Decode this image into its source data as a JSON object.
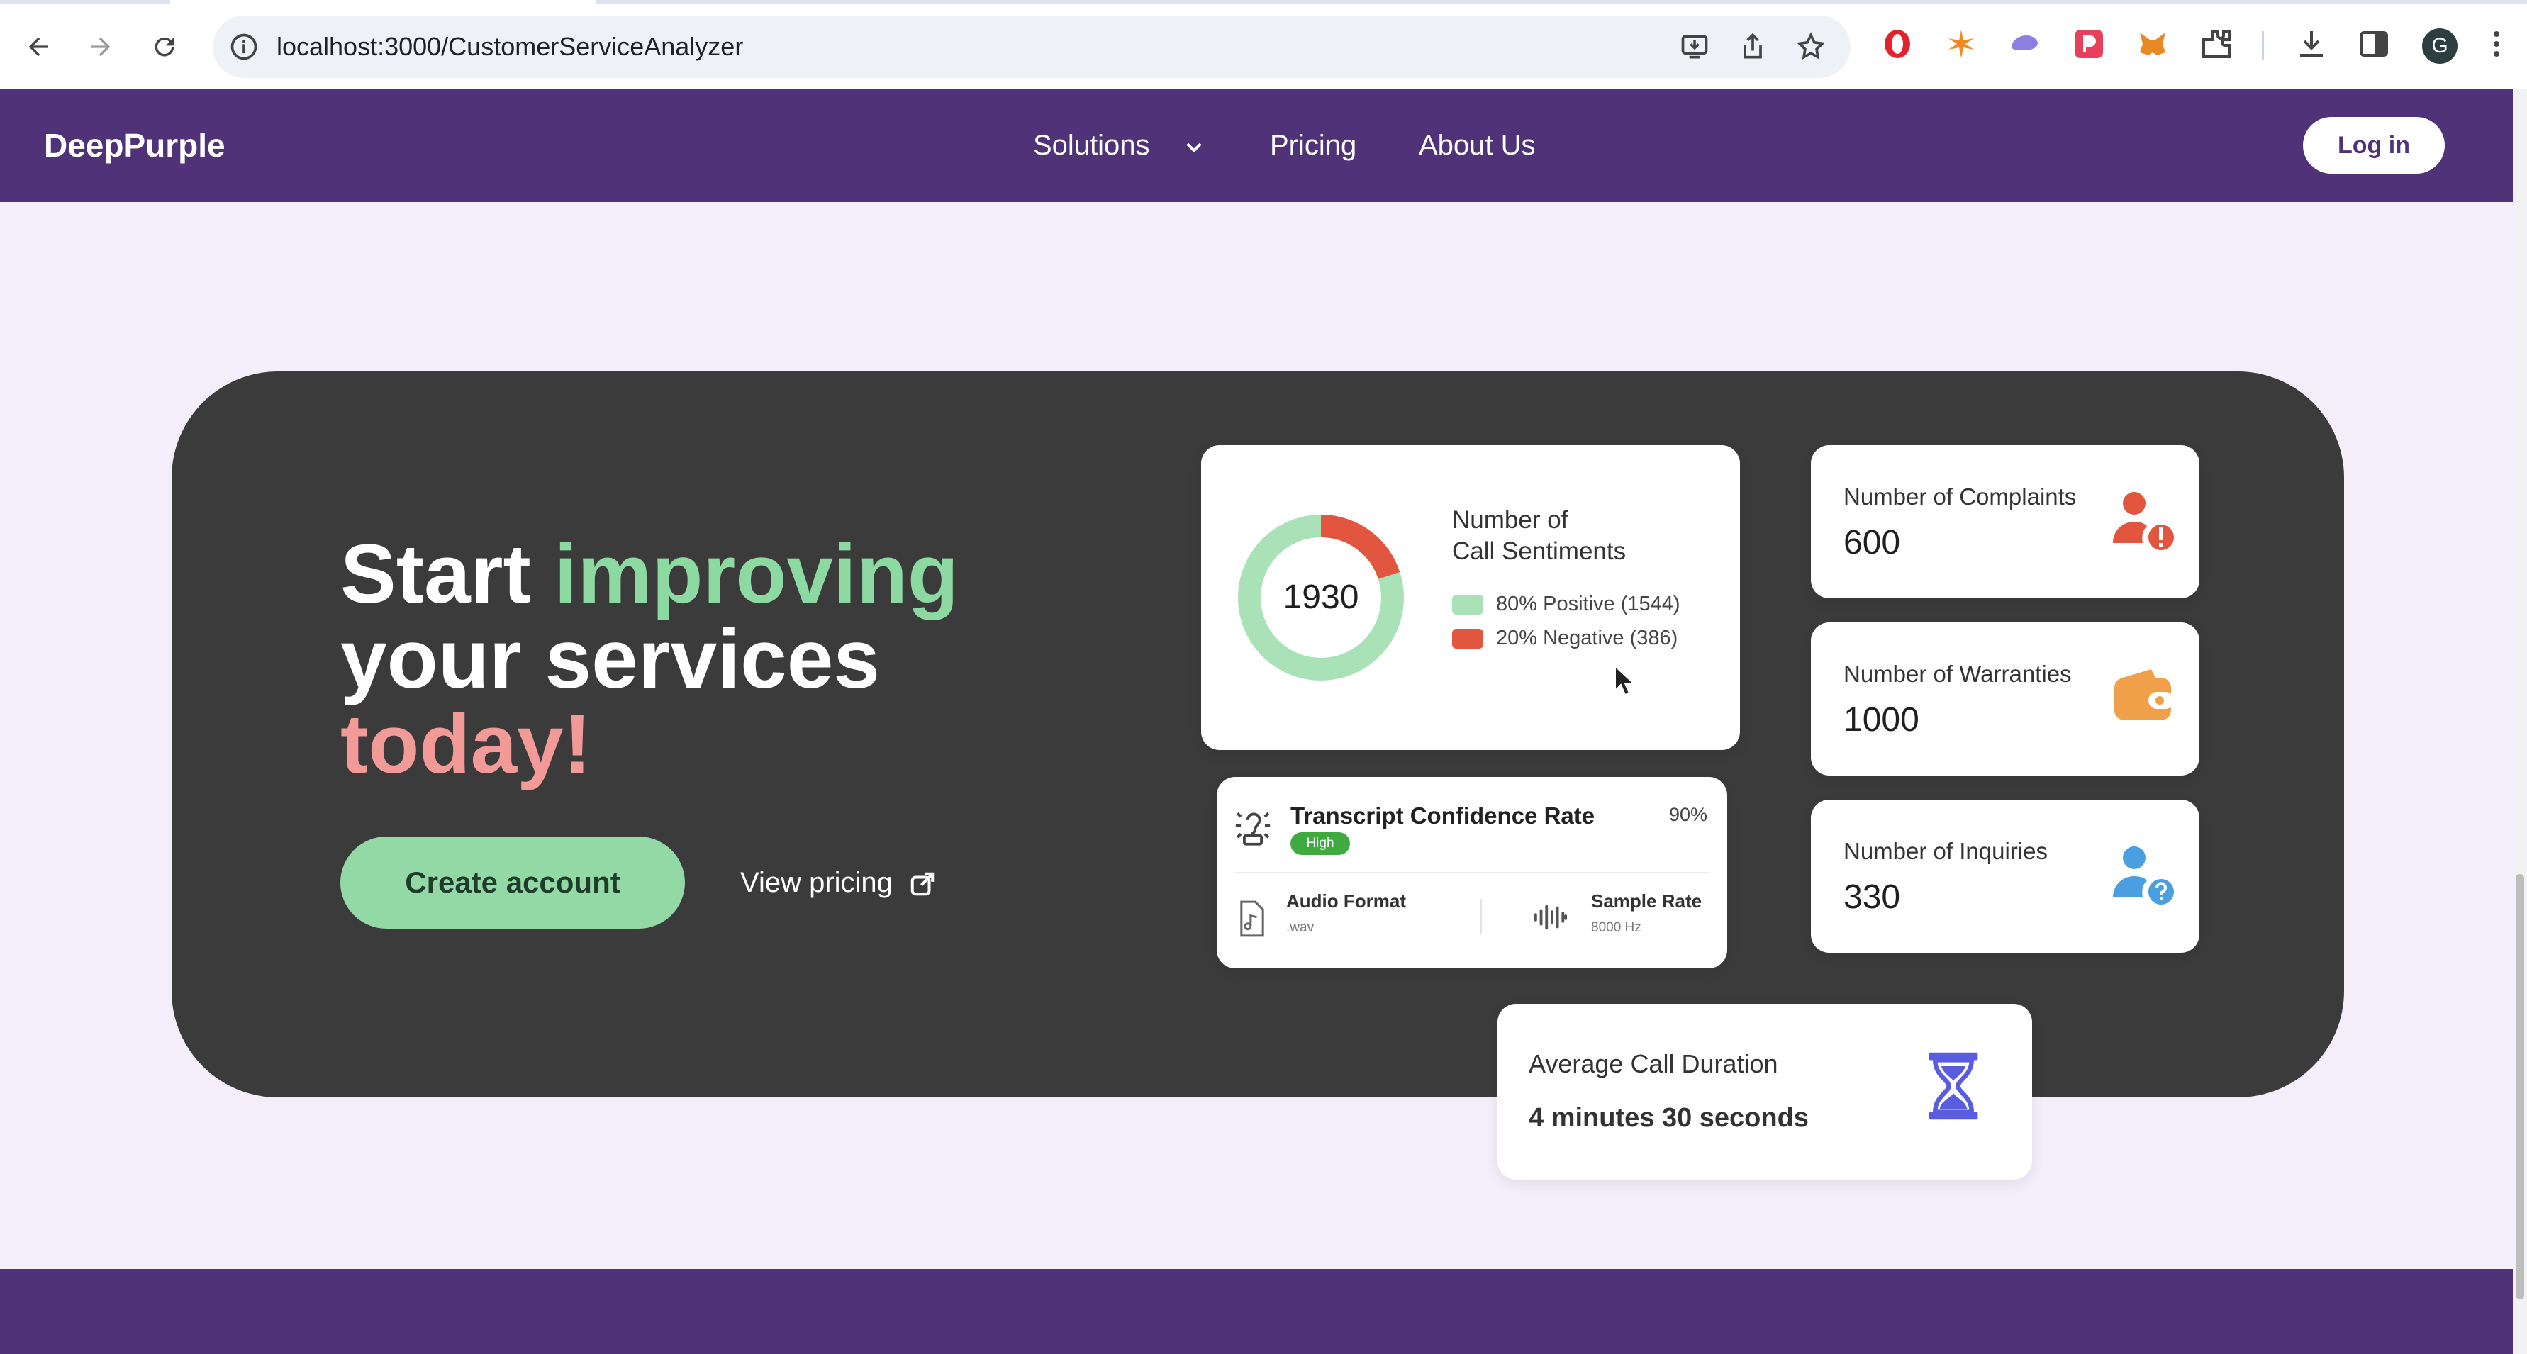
{
  "browser": {
    "url": "localhost:3000/CustomerServiceAnalyzer",
    "profile_initial": "G"
  },
  "site": {
    "brand": "DeepPurple",
    "nav": {
      "solutions": "Solutions",
      "pricing": "Pricing",
      "about": "About Us"
    },
    "login": "Log in"
  },
  "hero": {
    "headline": {
      "w1": "Start",
      "w2": "improving",
      "w3": "your services",
      "w4": "today!"
    },
    "cta": "Create account",
    "view_pricing": "View pricing"
  },
  "sentiments": {
    "total": "1930",
    "title_line1": "Number of",
    "title_line2": "Call Sentiments",
    "positive_label": "80% Positive (1544)",
    "negative_label": "20% Negative (386)",
    "positive_fraction": 0.8,
    "negative_fraction": 0.2,
    "positive_color": "#a8e2b6",
    "negative_color": "#e2553f"
  },
  "transcript": {
    "title": "Transcript Confidence Rate",
    "percent": "90%",
    "badge": "High",
    "audio_format_label": "Audio Format",
    "audio_format_value": ".wav",
    "sample_rate_label": "Sample Rate",
    "sample_rate_value": "8000 Hz"
  },
  "stats": {
    "complaints": {
      "label": "Number of Complaints",
      "value": "600",
      "icon": "user-alert-icon"
    },
    "warranties": {
      "label": "Number of Warranties",
      "value": "1000",
      "icon": "wallet-icon"
    },
    "inquiries": {
      "label": "Number of Inquiries",
      "value": "330",
      "icon": "user-question-icon"
    }
  },
  "duration": {
    "label": "Average Call Duration",
    "value": "4 minutes 30 seconds"
  },
  "colors": {
    "brand_purple": "#4f3277",
    "hero_bg": "#3b3b3b",
    "accent_green": "#8dd9a2",
    "accent_pink": "#f29a98",
    "complaint_red": "#e2553f",
    "warranty_orange": "#f0a048",
    "inquiry_blue": "#4a9fe0",
    "hourglass_indigo": "#5a5ce0"
  }
}
